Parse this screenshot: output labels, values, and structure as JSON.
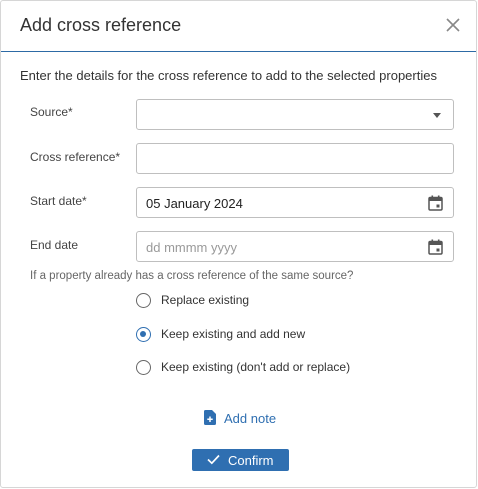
{
  "dialog": {
    "title": "Add cross reference",
    "close_icon": "close-icon",
    "intro": "Enter the details for the cross reference to add to the selected properties"
  },
  "form": {
    "source": {
      "label": "Source*",
      "value": "",
      "icon": "caret-down-icon"
    },
    "cross_reference": {
      "label": "Cross reference*",
      "value": ""
    },
    "start_date": {
      "label": "Start date*",
      "value": "05 January 2024",
      "icon": "calendar-icon"
    },
    "end_date": {
      "label": "End date",
      "value": "",
      "placeholder": "dd mmmm yyyy",
      "icon": "calendar-icon"
    }
  },
  "conflict": {
    "question": "If a property already has a cross reference of the same source?",
    "options": [
      {
        "label": "Replace existing",
        "selected": false
      },
      {
        "label": "Keep existing and add new",
        "selected": true
      },
      {
        "label": "Keep existing (don't add or replace)",
        "selected": false
      }
    ]
  },
  "actions": {
    "add_note": "Add note",
    "confirm": "Confirm"
  },
  "colors": {
    "accent": "#2f6fb1",
    "header_rule": "#2d6aa5",
    "field_border": "#bfbfbf"
  }
}
